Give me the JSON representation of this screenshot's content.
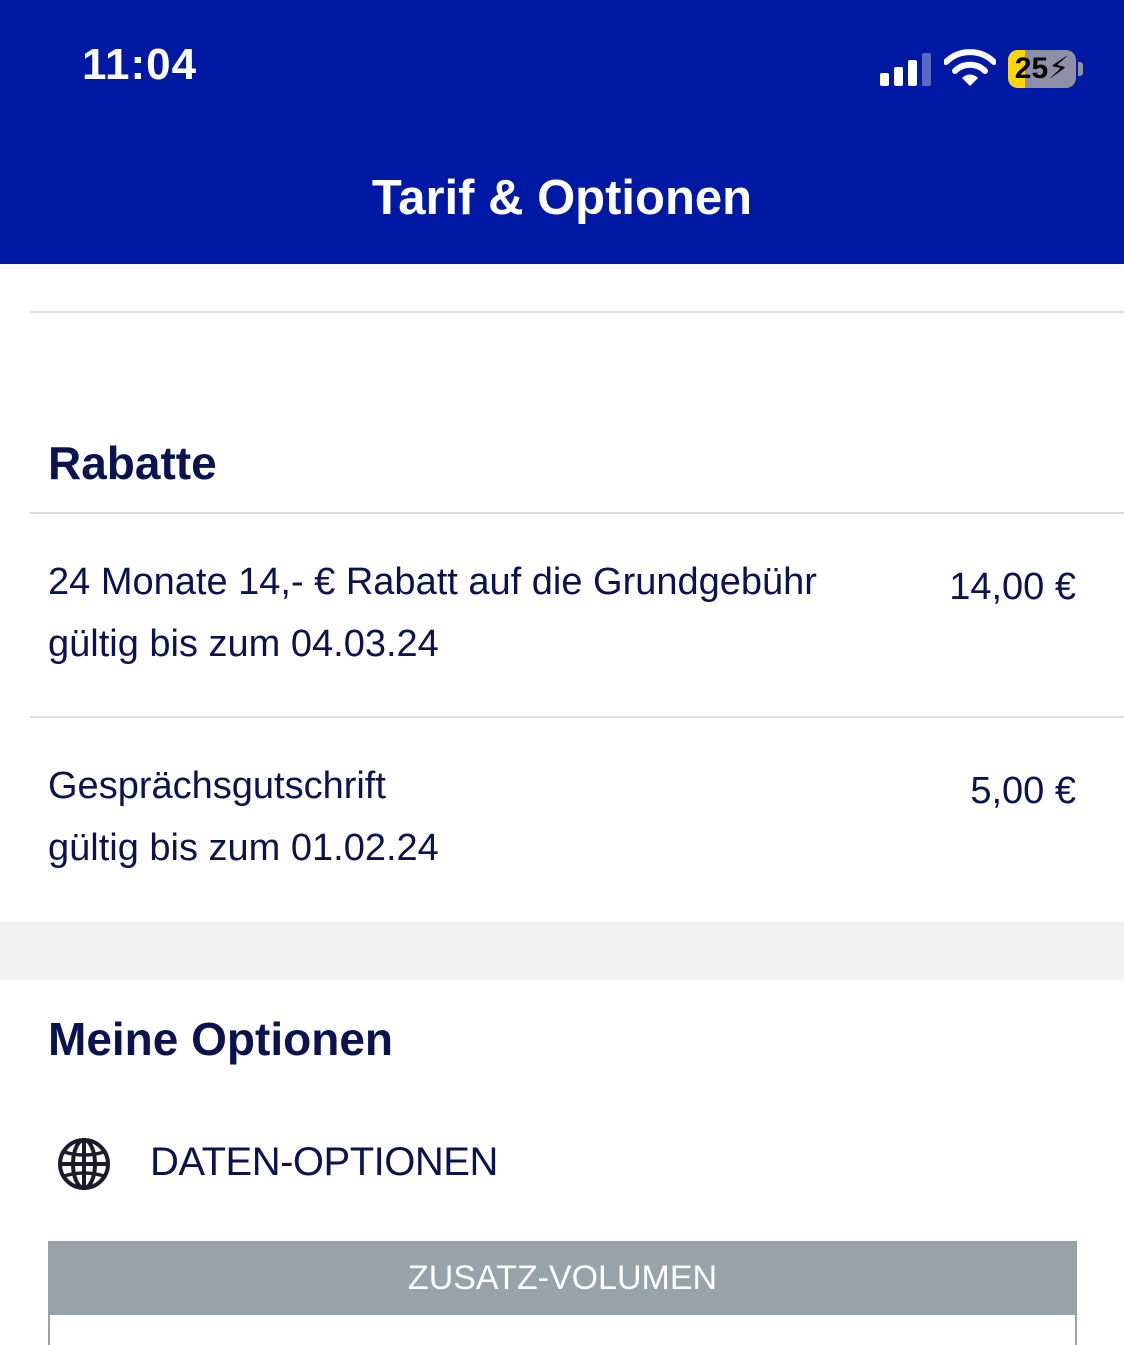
{
  "status_bar": {
    "time": "11:04",
    "battery_level": "25",
    "battery_fraction": 0.25,
    "signal_bars_active": 3,
    "signal_bars_total": 4
  },
  "header": {
    "title": "Tarif & Optionen",
    "background_color": "#0019a5"
  },
  "rabatte": {
    "title": "Rabatte",
    "items": [
      {
        "label": "24 Monate 14,- € Rabatt auf die Grundgebühr",
        "validity": "gültig bis zum 04.03.24",
        "amount": "14,00 €"
      },
      {
        "label": "Gesprächsgutschrift",
        "validity": "gültig bis zum 01.02.24",
        "amount": "5,00 €"
      }
    ]
  },
  "optionen": {
    "title": "Meine Optionen",
    "category": {
      "icon": "globe-icon",
      "label": "DATEN-OPTIONEN"
    },
    "tab": {
      "label": "ZUSATZ-VOLUMEN",
      "color": "#97a3a8"
    }
  },
  "colors": {
    "text_primary": "#0a1250",
    "divider": "#dcdcdc",
    "section_gap": "#f2f2f3"
  }
}
